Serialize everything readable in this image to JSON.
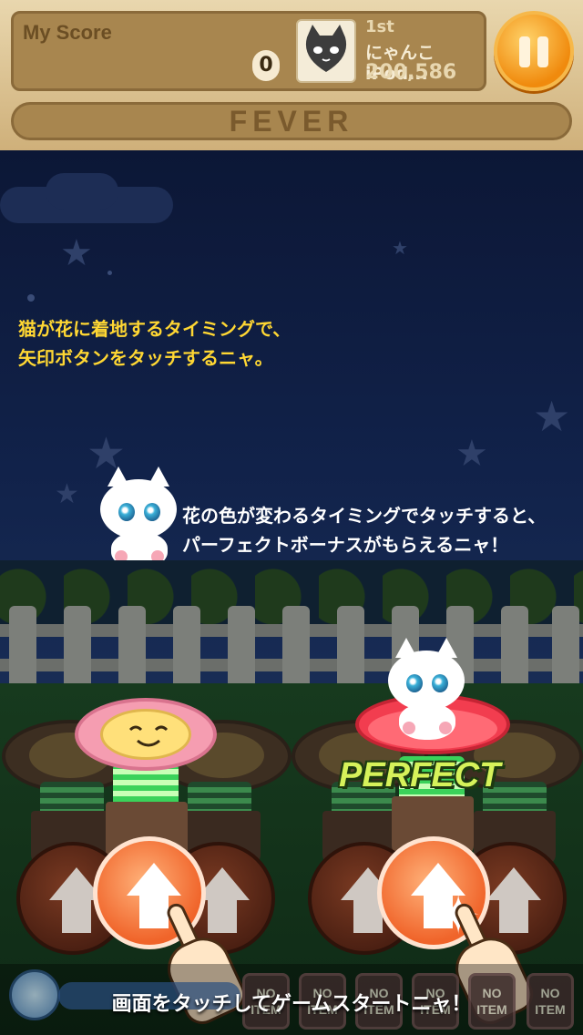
{
  "header": {
    "my_score_label": "My Score",
    "my_score_value": "0",
    "rank_position": "1st",
    "rank_name": "にゃんこiPod...",
    "rank_score": "200,586",
    "fever_label": "FEVER"
  },
  "tutorial": {
    "tip_landing_line1": "猫が花に着地するタイミングで、",
    "tip_landing_line2": "矢印ボタンをタッチするニャ。",
    "tip_perfect_line1": "花の色が変わるタイミングでタッチすると、",
    "tip_perfect_line2": "パーフェクトボーナスがもらえるニャ！",
    "perfect_text": "PERFECT",
    "start_message": "画面をタッチしてゲームスタートニャ！"
  },
  "items": [
    {
      "line1": "NO",
      "line2": "ITEM"
    },
    {
      "line1": "NO",
      "line2": "ITEM"
    },
    {
      "line1": "NO",
      "line2": "ITEM"
    },
    {
      "line1": "NO",
      "line2": "ITEM"
    },
    {
      "line1": "NO",
      "line2": "ITEM"
    },
    {
      "line1": "NO",
      "line2": "ITEM"
    }
  ],
  "icons": [
    "cat-avatar-icon",
    "pause-icon",
    "arrow-up-icon",
    "pointing-hand-icon",
    "alarm-clock-icon"
  ],
  "colors": {
    "tip_highlight": "#ffd733",
    "perfect": "#d6f25a",
    "pause_button": "#f08a0d",
    "lit_button": "#f0642a"
  }
}
